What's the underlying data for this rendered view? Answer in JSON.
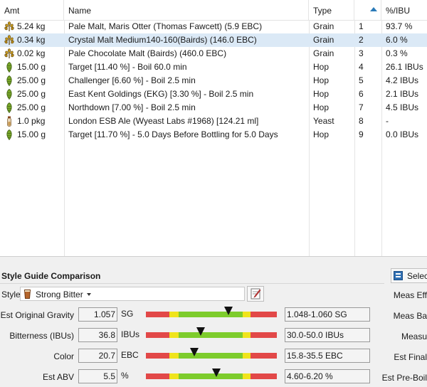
{
  "grid": {
    "columns": {
      "amount": "Amt",
      "name": "Name",
      "type": "Type",
      "ibu": "%/IBU"
    },
    "rows": [
      {
        "icon": "grain-icon",
        "amount": "5.24 kg",
        "name": "Pale Malt, Maris Otter (Thomas Fawcett) (5.9 EBC)",
        "type": "Grain",
        "step": "1",
        "ibu": "93.7 %"
      },
      {
        "icon": "grain-icon",
        "amount": "0.34 kg",
        "name": "Crystal Malt Medium140-160(Bairds) (146.0 EBC)",
        "type": "Grain",
        "step": "2",
        "ibu": "6.0 %"
      },
      {
        "icon": "grain-icon",
        "amount": "0.02 kg",
        "name": "Pale Chocolate Malt (Bairds) (460.0 EBC)",
        "type": "Grain",
        "step": "3",
        "ibu": "0.3 %"
      },
      {
        "icon": "hop-icon",
        "amount": "15.00 g",
        "name": "Target [11.40 %] - Boil 60.0 min",
        "type": "Hop",
        "step": "4",
        "ibu": "26.1 IBUs"
      },
      {
        "icon": "hop-icon",
        "amount": "25.00 g",
        "name": "Challenger [6.60 %] - Boil 2.5 min",
        "type": "Hop",
        "step": "5",
        "ibu": "4.2 IBUs"
      },
      {
        "icon": "hop-icon",
        "amount": "25.00 g",
        "name": "East Kent Goldings (EKG) [3.30 %] - Boil 2.5 min",
        "type": "Hop",
        "step": "6",
        "ibu": "2.1 IBUs"
      },
      {
        "icon": "hop-icon",
        "amount": "25.00 g",
        "name": "Northdown [7.00 %] - Boil 2.5 min",
        "type": "Hop",
        "step": "7",
        "ibu": "4.5 IBUs"
      },
      {
        "icon": "yeast-vial-icon",
        "amount": "1.0 pkg",
        "name": "London ESB Ale (Wyeast Labs #1968) [124.21 ml]",
        "type": "Yeast",
        "step": "8",
        "ibu": "-"
      },
      {
        "icon": "hop-icon",
        "amount": "15.00 g",
        "name": "Target [11.70 %] - 5.0 Days Before Bottling for 5.0 Days",
        "type": "Hop",
        "step": "9",
        "ibu": "0.0 IBUs"
      }
    ],
    "selected_row": 1
  },
  "style_guide": {
    "title": "Style Guide Comparison",
    "style_label": "Style",
    "style_value": "Strong Bitter",
    "stats": [
      {
        "label": "Est Original Gravity",
        "value": "1.057",
        "unit": "SG",
        "range": "1.048-1.060 SG",
        "marker": 0.63
      },
      {
        "label": "Bitterness (IBUs)",
        "value": "36.8",
        "unit": "IBUs",
        "range": "30.0-50.0 IBUs",
        "marker": 0.42
      },
      {
        "label": "Color",
        "value": "20.7",
        "unit": "EBC",
        "range": "15.8-35.5 EBC",
        "marker": 0.37
      },
      {
        "label": "Est ABV",
        "value": "5.5",
        "unit": "%",
        "range": "4.60-6.20 %",
        "marker": 0.54
      }
    ]
  },
  "right_panel": {
    "select_button": "Select",
    "labels": [
      "Meas Eff",
      "Meas Ba",
      "Measu",
      "Est Final",
      "Est Pre-Boil"
    ]
  },
  "colors": {
    "meter_red": "#e24848",
    "meter_yellow": "#f0e41c",
    "meter_green": "#7dcc2c",
    "selected_row": "#dbe9f6",
    "sort_arrow": "#2a7ab8"
  }
}
